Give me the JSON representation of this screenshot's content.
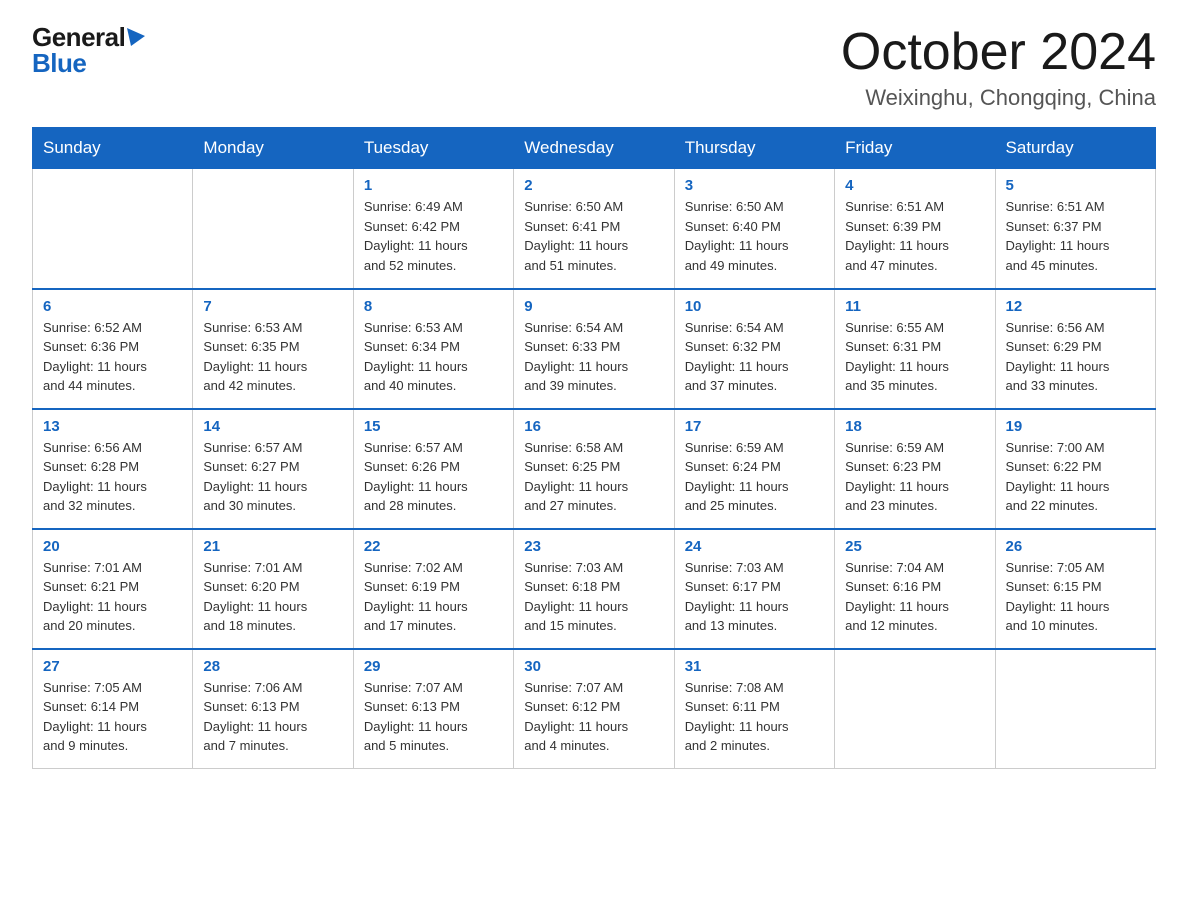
{
  "header": {
    "logo_general": "General",
    "logo_blue": "Blue",
    "title": "October 2024",
    "location": "Weixinghu, Chongqing, China"
  },
  "weekdays": [
    "Sunday",
    "Monday",
    "Tuesday",
    "Wednesday",
    "Thursday",
    "Friday",
    "Saturday"
  ],
  "weeks": [
    [
      {
        "day": "",
        "info": ""
      },
      {
        "day": "",
        "info": ""
      },
      {
        "day": "1",
        "info": "Sunrise: 6:49 AM\nSunset: 6:42 PM\nDaylight: 11 hours\nand 52 minutes."
      },
      {
        "day": "2",
        "info": "Sunrise: 6:50 AM\nSunset: 6:41 PM\nDaylight: 11 hours\nand 51 minutes."
      },
      {
        "day": "3",
        "info": "Sunrise: 6:50 AM\nSunset: 6:40 PM\nDaylight: 11 hours\nand 49 minutes."
      },
      {
        "day": "4",
        "info": "Sunrise: 6:51 AM\nSunset: 6:39 PM\nDaylight: 11 hours\nand 47 minutes."
      },
      {
        "day": "5",
        "info": "Sunrise: 6:51 AM\nSunset: 6:37 PM\nDaylight: 11 hours\nand 45 minutes."
      }
    ],
    [
      {
        "day": "6",
        "info": "Sunrise: 6:52 AM\nSunset: 6:36 PM\nDaylight: 11 hours\nand 44 minutes."
      },
      {
        "day": "7",
        "info": "Sunrise: 6:53 AM\nSunset: 6:35 PM\nDaylight: 11 hours\nand 42 minutes."
      },
      {
        "day": "8",
        "info": "Sunrise: 6:53 AM\nSunset: 6:34 PM\nDaylight: 11 hours\nand 40 minutes."
      },
      {
        "day": "9",
        "info": "Sunrise: 6:54 AM\nSunset: 6:33 PM\nDaylight: 11 hours\nand 39 minutes."
      },
      {
        "day": "10",
        "info": "Sunrise: 6:54 AM\nSunset: 6:32 PM\nDaylight: 11 hours\nand 37 minutes."
      },
      {
        "day": "11",
        "info": "Sunrise: 6:55 AM\nSunset: 6:31 PM\nDaylight: 11 hours\nand 35 minutes."
      },
      {
        "day": "12",
        "info": "Sunrise: 6:56 AM\nSunset: 6:29 PM\nDaylight: 11 hours\nand 33 minutes."
      }
    ],
    [
      {
        "day": "13",
        "info": "Sunrise: 6:56 AM\nSunset: 6:28 PM\nDaylight: 11 hours\nand 32 minutes."
      },
      {
        "day": "14",
        "info": "Sunrise: 6:57 AM\nSunset: 6:27 PM\nDaylight: 11 hours\nand 30 minutes."
      },
      {
        "day": "15",
        "info": "Sunrise: 6:57 AM\nSunset: 6:26 PM\nDaylight: 11 hours\nand 28 minutes."
      },
      {
        "day": "16",
        "info": "Sunrise: 6:58 AM\nSunset: 6:25 PM\nDaylight: 11 hours\nand 27 minutes."
      },
      {
        "day": "17",
        "info": "Sunrise: 6:59 AM\nSunset: 6:24 PM\nDaylight: 11 hours\nand 25 minutes."
      },
      {
        "day": "18",
        "info": "Sunrise: 6:59 AM\nSunset: 6:23 PM\nDaylight: 11 hours\nand 23 minutes."
      },
      {
        "day": "19",
        "info": "Sunrise: 7:00 AM\nSunset: 6:22 PM\nDaylight: 11 hours\nand 22 minutes."
      }
    ],
    [
      {
        "day": "20",
        "info": "Sunrise: 7:01 AM\nSunset: 6:21 PM\nDaylight: 11 hours\nand 20 minutes."
      },
      {
        "day": "21",
        "info": "Sunrise: 7:01 AM\nSunset: 6:20 PM\nDaylight: 11 hours\nand 18 minutes."
      },
      {
        "day": "22",
        "info": "Sunrise: 7:02 AM\nSunset: 6:19 PM\nDaylight: 11 hours\nand 17 minutes."
      },
      {
        "day": "23",
        "info": "Sunrise: 7:03 AM\nSunset: 6:18 PM\nDaylight: 11 hours\nand 15 minutes."
      },
      {
        "day": "24",
        "info": "Sunrise: 7:03 AM\nSunset: 6:17 PM\nDaylight: 11 hours\nand 13 minutes."
      },
      {
        "day": "25",
        "info": "Sunrise: 7:04 AM\nSunset: 6:16 PM\nDaylight: 11 hours\nand 12 minutes."
      },
      {
        "day": "26",
        "info": "Sunrise: 7:05 AM\nSunset: 6:15 PM\nDaylight: 11 hours\nand 10 minutes."
      }
    ],
    [
      {
        "day": "27",
        "info": "Sunrise: 7:05 AM\nSunset: 6:14 PM\nDaylight: 11 hours\nand 9 minutes."
      },
      {
        "day": "28",
        "info": "Sunrise: 7:06 AM\nSunset: 6:13 PM\nDaylight: 11 hours\nand 7 minutes."
      },
      {
        "day": "29",
        "info": "Sunrise: 7:07 AM\nSunset: 6:13 PM\nDaylight: 11 hours\nand 5 minutes."
      },
      {
        "day": "30",
        "info": "Sunrise: 7:07 AM\nSunset: 6:12 PM\nDaylight: 11 hours\nand 4 minutes."
      },
      {
        "day": "31",
        "info": "Sunrise: 7:08 AM\nSunset: 6:11 PM\nDaylight: 11 hours\nand 2 minutes."
      },
      {
        "day": "",
        "info": ""
      },
      {
        "day": "",
        "info": ""
      }
    ]
  ]
}
